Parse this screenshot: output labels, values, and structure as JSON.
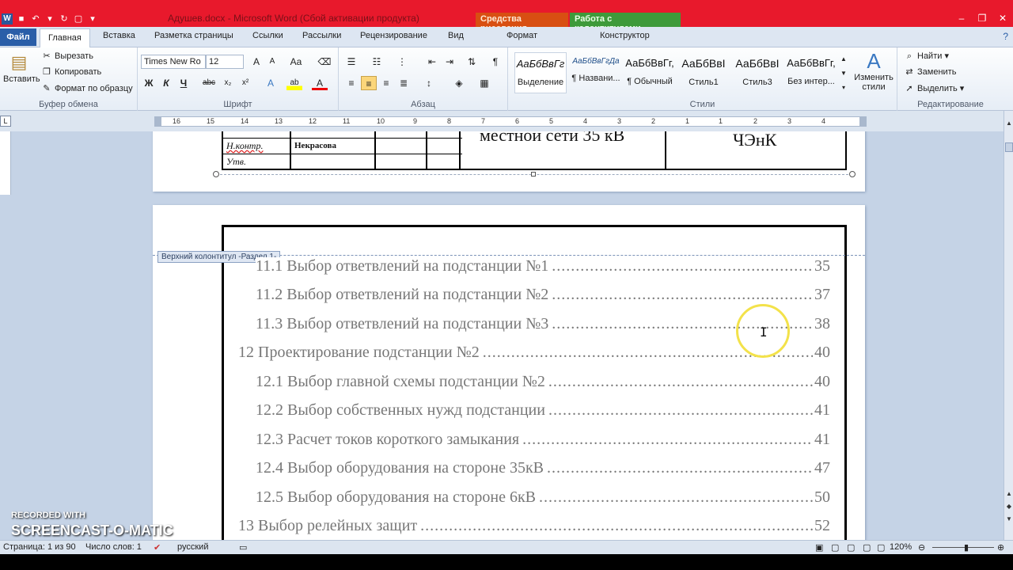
{
  "titlebar": {
    "title": "Адушев.docx  -  Microsoft Word (Сбой активации продукта)",
    "context_drawing": "Средства рисования",
    "context_headerfooter": "Работа с колонтитулами",
    "app_icon": "W"
  },
  "tabs": {
    "file": "Файл",
    "home": "Главная",
    "insert": "Вставка",
    "layout": "Разметка страницы",
    "references": "Ссылки",
    "mailings": "Рассылки",
    "review": "Рецензирование",
    "view": "Вид",
    "format": "Формат",
    "constructor": "Конструктор"
  },
  "clipboard": {
    "paste": "Вставить",
    "cut": "Вырезать",
    "copy": "Копировать",
    "format_painter": "Формат по образцу",
    "label": "Буфер обмена"
  },
  "font": {
    "name": "Times New Ro",
    "size": "12",
    "label": "Шрифт",
    "bold": "Ж",
    "italic": "К",
    "underline": "Ч",
    "strike": "abc",
    "sub": "x₂",
    "sup": "x²",
    "grow": "A",
    "shrink": "A",
    "case": "Aa",
    "effects": "A",
    "highlight": "ab",
    "color": "A"
  },
  "paragraph": {
    "label": "Абзац",
    "pilcrow": "¶"
  },
  "styles": {
    "label": "Стили",
    "items": [
      {
        "sample": "АаБбВвГг",
        "name": "Выделение"
      },
      {
        "sample": "АаБбВвГгДа",
        "name": "¶ Названи..."
      },
      {
        "sample": "АаБбВвГг,",
        "name": "¶ Обычный"
      },
      {
        "sample": "АаБбВвI",
        "name": "Стиль1"
      },
      {
        "sample": "АаБбВвI",
        "name": "Стиль3"
      },
      {
        "sample": "АаБбВвГг,",
        "name": "Без интер..."
      }
    ],
    "change": "Изменить стили"
  },
  "editing": {
    "label": "Редактирование",
    "find": "Найти",
    "replace": "Заменить",
    "select": "Выделить"
  },
  "ruler": {
    "numbers": [
      "16",
      "15",
      "14",
      "13",
      "12",
      "11",
      "10",
      "9",
      "8",
      "7",
      "6",
      "5",
      "4",
      "3",
      "2",
      "1",
      "1",
      "2",
      "3",
      "4"
    ]
  },
  "stamp": {
    "nkontr_label": "Н.контр.",
    "nkontr_name": "Некрасова",
    "utv_label": "Утв.",
    "center_text": "местной сети 35 кВ",
    "right_text": "ЧЭнК"
  },
  "header_tag": "Верхний колонтитул -Раздел 1-",
  "toc": [
    {
      "text": "11.1 Выбор ответвлений на подстанции №1",
      "page": "35",
      "level": 2
    },
    {
      "text": "11.2 Выбор ответвлений на подстанции №2",
      "page": "37",
      "level": 2
    },
    {
      "text": "11.3 Выбор ответвлений на подстанции №3",
      "page": "38",
      "level": 2
    },
    {
      "text": "12 Проектирование подстанции №2",
      "page": "40",
      "level": 1
    },
    {
      "text": "12.1 Выбор главной схемы подстанции №2",
      "page": "40",
      "level": 2
    },
    {
      "text": "12.2 Выбор собственных нужд подстанции",
      "page": "41",
      "level": 2
    },
    {
      "text": "12.3 Расчет токов короткого замыкания",
      "page": "41",
      "level": 2
    },
    {
      "text": "12.4 Выбор оборудования на стороне 35кВ",
      "page": "47",
      "level": 2
    },
    {
      "text": "12.5 Выбор оборудования на стороне 6кВ",
      "page": "50",
      "level": 2
    },
    {
      "text": "13 Выбор релейных защит",
      "page": "52",
      "level": 1
    }
  ],
  "status": {
    "page": "Страница: 1 из 90",
    "words": "Число слов: 1",
    "language": "русский",
    "zoom": "120%"
  },
  "watermark": {
    "recorded": "RECORDED WITH",
    "brand": "SCREENCAST-O-MATIC"
  }
}
